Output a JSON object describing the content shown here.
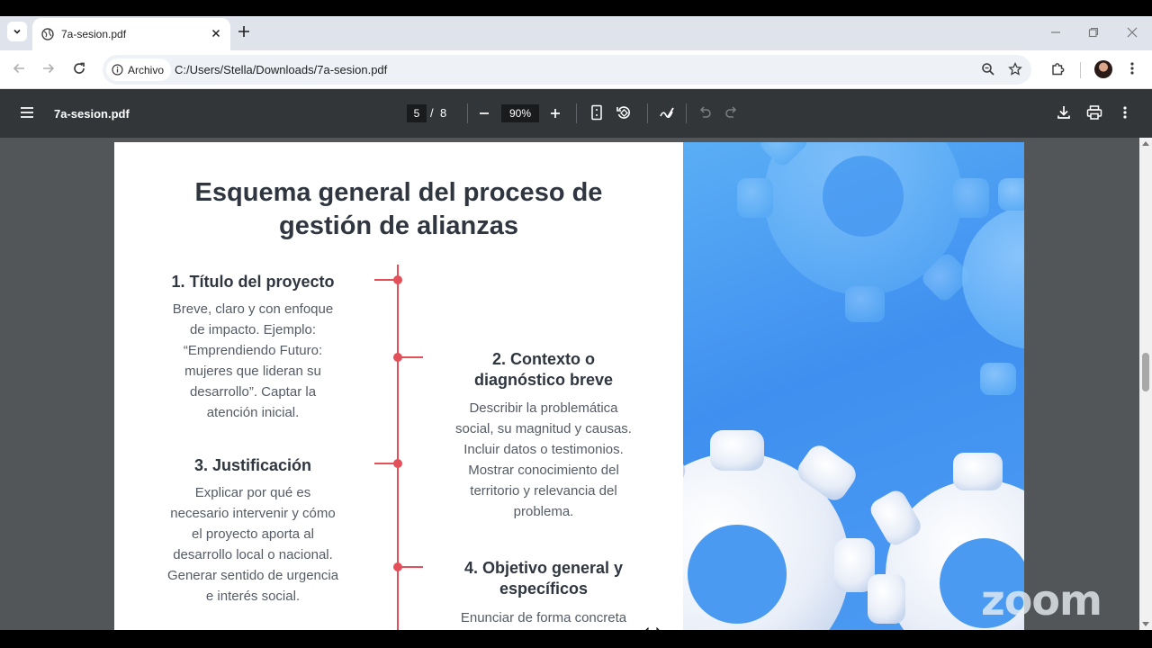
{
  "browser": {
    "tab_title": "7a-sesion.pdf",
    "address_chip": "Archivo",
    "url": "C:/Users/Stella/Downloads/7a-sesion.pdf"
  },
  "pdf_toolbar": {
    "file_name": "7a-sesion.pdf",
    "current_page": "5",
    "page_separator": "/",
    "total_pages": "8",
    "zoom": "90%"
  },
  "slide": {
    "title_line1": "Esquema general del proceso de",
    "title_line2": "gestión de alianzas",
    "sections": [
      {
        "title": "1. Título del proyecto",
        "lines": [
          "Breve, claro y con enfoque",
          "de impacto. Ejemplo:",
          "“Emprendiendo Futuro:",
          "mujeres que lideran su",
          "desarrollo”. Captar la",
          "atención inicial."
        ]
      },
      {
        "title_lines": [
          "2. Contexto o",
          "diagnóstico breve"
        ],
        "lines": [
          "Describir la problemática",
          "social, su magnitud y causas.",
          "Incluir datos o testimonios.",
          "Mostrar conocimiento del",
          "territorio y relevancia del",
          "problema."
        ]
      },
      {
        "title": "3. Justificación",
        "lines": [
          "Explicar por qué es",
          "necesario intervenir y cómo",
          "el proyecto aporta al",
          "desarrollo local o nacional.",
          "Generar sentido de urgencia",
          "e interés social."
        ]
      },
      {
        "title_lines": [
          "4. Objetivo general y",
          "específicos"
        ],
        "lines": [
          "Enunciar de forma concreta"
        ]
      }
    ]
  },
  "watermark": "zoom",
  "colors": {
    "timeline": "#e3505a",
    "heading": "#2f3640",
    "pdf_toolbar_bg": "#323639",
    "viewer_bg": "#525659"
  }
}
